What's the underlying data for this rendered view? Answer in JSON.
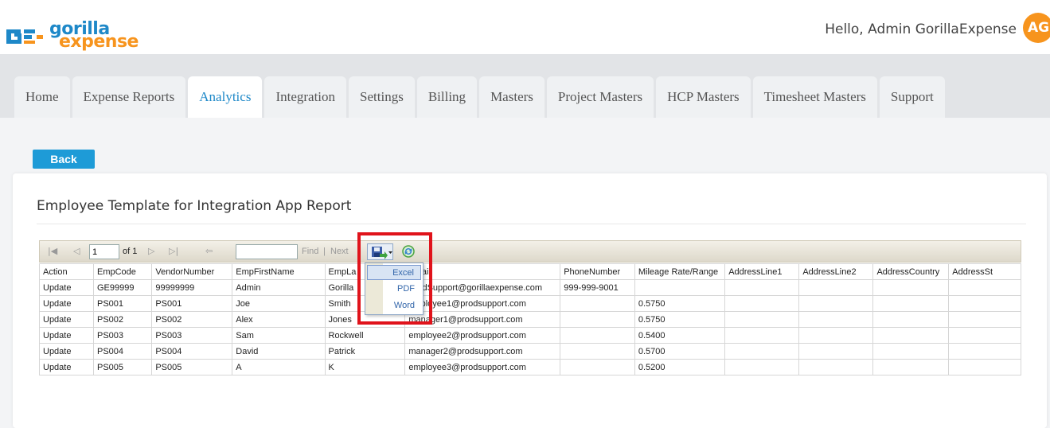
{
  "header": {
    "logo_text_1": "gorilla",
    "logo_text_2": "expense",
    "greeting": "Hello, Admin GorillaExpense",
    "avatar_initials": "AG",
    "brand_blue": "#1e88c8",
    "brand_orange": "#f7941d"
  },
  "nav": {
    "tabs": [
      {
        "label": "Home"
      },
      {
        "label": "Expense Reports"
      },
      {
        "label": "Analytics"
      },
      {
        "label": "Integration"
      },
      {
        "label": "Settings"
      },
      {
        "label": "Billing"
      },
      {
        "label": "Masters"
      },
      {
        "label": "Project Masters"
      },
      {
        "label": "HCP Masters"
      },
      {
        "label": "Timesheet Masters"
      },
      {
        "label": "Support"
      }
    ],
    "active_tab": "Analytics"
  },
  "back_button": "Back",
  "report": {
    "title": "Employee Template for Integration App Report",
    "toolbar": {
      "page_value": "1",
      "of_label": "of 1",
      "find_label": "Find",
      "separator": "|",
      "next_label": "Next",
      "find_value": ""
    },
    "export_menu": {
      "items": [
        "Excel",
        "PDF",
        "Word"
      ],
      "highlighted": "Excel"
    },
    "columns": [
      "Action",
      "EmpCode",
      "VendorNumber",
      "EmpFirstName",
      "EmpLa",
      "Email",
      "PhoneNumber",
      "Mileage Rate/Range",
      "AddressLine1",
      "AddressLine2",
      "AddressCountry",
      "AddressSt"
    ],
    "rows": [
      [
        "Update",
        "GE99999",
        "99999999",
        "Admin",
        "Gorilla",
        "ProdSupport@gorillaexpense.com",
        "999-999-9001",
        "",
        "",
        "",
        "",
        ""
      ],
      [
        "Update",
        "PS001",
        "PS001",
        "Joe",
        "Smith",
        "employee1@prodsupport.com",
        "",
        "0.5750",
        "",
        "",
        "",
        ""
      ],
      [
        "Update",
        "PS002",
        "PS002",
        "Alex",
        "Jones",
        "manager1@prodsupport.com",
        "",
        "0.5750",
        "",
        "",
        "",
        ""
      ],
      [
        "Update",
        "PS003",
        "PS003",
        "Sam",
        "Rockwell",
        "employee2@prodsupport.com",
        "",
        "0.5400",
        "",
        "",
        "",
        ""
      ],
      [
        "Update",
        "PS004",
        "PS004",
        "David",
        "Patrick",
        "manager2@prodsupport.com",
        "",
        "0.5700",
        "",
        "",
        "",
        ""
      ],
      [
        "Update",
        "PS005",
        "PS005",
        "A",
        "K",
        "employee3@prodsupport.com",
        "",
        "0.5200",
        "",
        "",
        "",
        ""
      ]
    ]
  },
  "annotation_color": "#e0131b"
}
